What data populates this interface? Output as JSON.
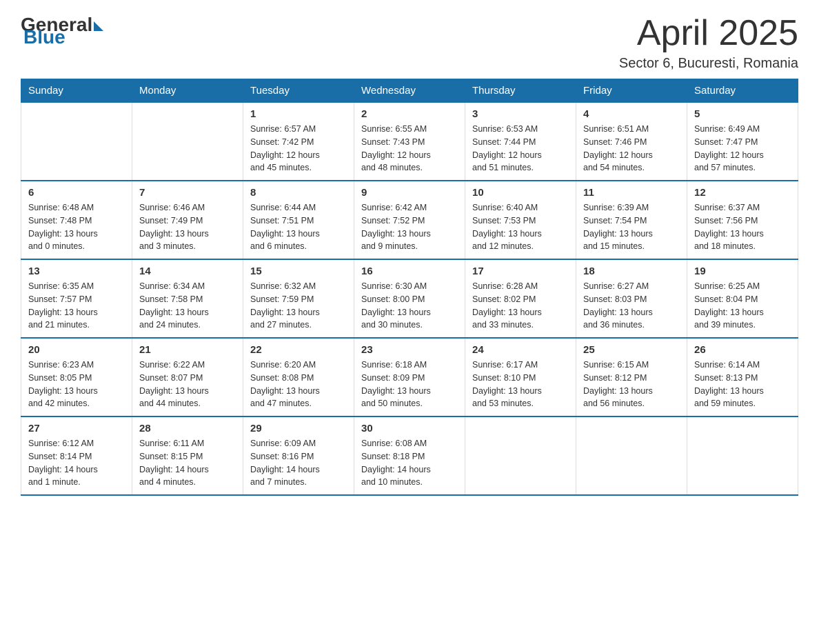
{
  "header": {
    "logo": {
      "general": "General",
      "blue": "Blue"
    },
    "title": "April 2025",
    "subtitle": "Sector 6, Bucuresti, Romania"
  },
  "calendar": {
    "days_of_week": [
      "Sunday",
      "Monday",
      "Tuesday",
      "Wednesday",
      "Thursday",
      "Friday",
      "Saturday"
    ],
    "weeks": [
      [
        {
          "day": "",
          "info": ""
        },
        {
          "day": "",
          "info": ""
        },
        {
          "day": "1",
          "info": "Sunrise: 6:57 AM\nSunset: 7:42 PM\nDaylight: 12 hours\nand 45 minutes."
        },
        {
          "day": "2",
          "info": "Sunrise: 6:55 AM\nSunset: 7:43 PM\nDaylight: 12 hours\nand 48 minutes."
        },
        {
          "day": "3",
          "info": "Sunrise: 6:53 AM\nSunset: 7:44 PM\nDaylight: 12 hours\nand 51 minutes."
        },
        {
          "day": "4",
          "info": "Sunrise: 6:51 AM\nSunset: 7:46 PM\nDaylight: 12 hours\nand 54 minutes."
        },
        {
          "day": "5",
          "info": "Sunrise: 6:49 AM\nSunset: 7:47 PM\nDaylight: 12 hours\nand 57 minutes."
        }
      ],
      [
        {
          "day": "6",
          "info": "Sunrise: 6:48 AM\nSunset: 7:48 PM\nDaylight: 13 hours\nand 0 minutes."
        },
        {
          "day": "7",
          "info": "Sunrise: 6:46 AM\nSunset: 7:49 PM\nDaylight: 13 hours\nand 3 minutes."
        },
        {
          "day": "8",
          "info": "Sunrise: 6:44 AM\nSunset: 7:51 PM\nDaylight: 13 hours\nand 6 minutes."
        },
        {
          "day": "9",
          "info": "Sunrise: 6:42 AM\nSunset: 7:52 PM\nDaylight: 13 hours\nand 9 minutes."
        },
        {
          "day": "10",
          "info": "Sunrise: 6:40 AM\nSunset: 7:53 PM\nDaylight: 13 hours\nand 12 minutes."
        },
        {
          "day": "11",
          "info": "Sunrise: 6:39 AM\nSunset: 7:54 PM\nDaylight: 13 hours\nand 15 minutes."
        },
        {
          "day": "12",
          "info": "Sunrise: 6:37 AM\nSunset: 7:56 PM\nDaylight: 13 hours\nand 18 minutes."
        }
      ],
      [
        {
          "day": "13",
          "info": "Sunrise: 6:35 AM\nSunset: 7:57 PM\nDaylight: 13 hours\nand 21 minutes."
        },
        {
          "day": "14",
          "info": "Sunrise: 6:34 AM\nSunset: 7:58 PM\nDaylight: 13 hours\nand 24 minutes."
        },
        {
          "day": "15",
          "info": "Sunrise: 6:32 AM\nSunset: 7:59 PM\nDaylight: 13 hours\nand 27 minutes."
        },
        {
          "day": "16",
          "info": "Sunrise: 6:30 AM\nSunset: 8:00 PM\nDaylight: 13 hours\nand 30 minutes."
        },
        {
          "day": "17",
          "info": "Sunrise: 6:28 AM\nSunset: 8:02 PM\nDaylight: 13 hours\nand 33 minutes."
        },
        {
          "day": "18",
          "info": "Sunrise: 6:27 AM\nSunset: 8:03 PM\nDaylight: 13 hours\nand 36 minutes."
        },
        {
          "day": "19",
          "info": "Sunrise: 6:25 AM\nSunset: 8:04 PM\nDaylight: 13 hours\nand 39 minutes."
        }
      ],
      [
        {
          "day": "20",
          "info": "Sunrise: 6:23 AM\nSunset: 8:05 PM\nDaylight: 13 hours\nand 42 minutes."
        },
        {
          "day": "21",
          "info": "Sunrise: 6:22 AM\nSunset: 8:07 PM\nDaylight: 13 hours\nand 44 minutes."
        },
        {
          "day": "22",
          "info": "Sunrise: 6:20 AM\nSunset: 8:08 PM\nDaylight: 13 hours\nand 47 minutes."
        },
        {
          "day": "23",
          "info": "Sunrise: 6:18 AM\nSunset: 8:09 PM\nDaylight: 13 hours\nand 50 minutes."
        },
        {
          "day": "24",
          "info": "Sunrise: 6:17 AM\nSunset: 8:10 PM\nDaylight: 13 hours\nand 53 minutes."
        },
        {
          "day": "25",
          "info": "Sunrise: 6:15 AM\nSunset: 8:12 PM\nDaylight: 13 hours\nand 56 minutes."
        },
        {
          "day": "26",
          "info": "Sunrise: 6:14 AM\nSunset: 8:13 PM\nDaylight: 13 hours\nand 59 minutes."
        }
      ],
      [
        {
          "day": "27",
          "info": "Sunrise: 6:12 AM\nSunset: 8:14 PM\nDaylight: 14 hours\nand 1 minute."
        },
        {
          "day": "28",
          "info": "Sunrise: 6:11 AM\nSunset: 8:15 PM\nDaylight: 14 hours\nand 4 minutes."
        },
        {
          "day": "29",
          "info": "Sunrise: 6:09 AM\nSunset: 8:16 PM\nDaylight: 14 hours\nand 7 minutes."
        },
        {
          "day": "30",
          "info": "Sunrise: 6:08 AM\nSunset: 8:18 PM\nDaylight: 14 hours\nand 10 minutes."
        },
        {
          "day": "",
          "info": ""
        },
        {
          "day": "",
          "info": ""
        },
        {
          "day": "",
          "info": ""
        }
      ]
    ]
  }
}
